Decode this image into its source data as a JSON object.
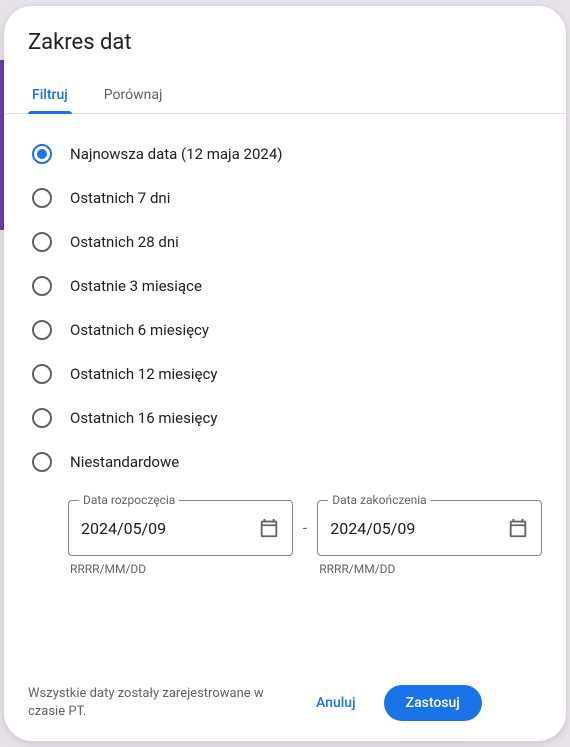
{
  "dialog": {
    "title": "Zakres dat",
    "tabs": {
      "filter": "Filtruj",
      "compare": "Porównaj"
    }
  },
  "options": [
    {
      "label": "Najnowsza data (12 maja 2024)",
      "selected": true
    },
    {
      "label": "Ostatnich 7 dni",
      "selected": false
    },
    {
      "label": "Ostatnich 28 dni",
      "selected": false
    },
    {
      "label": "Ostatnie 3 miesiące",
      "selected": false
    },
    {
      "label": "Ostatnich 6 miesięcy",
      "selected": false
    },
    {
      "label": "Ostatnich 12 miesięcy",
      "selected": false
    },
    {
      "label": "Ostatnich 16 miesięcy",
      "selected": false
    },
    {
      "label": "Niestandardowe",
      "selected": false
    }
  ],
  "dateStart": {
    "legend": "Data rozpoczęcia",
    "value": "2024/05/09",
    "hint": "RRRR/MM/DD"
  },
  "dateEnd": {
    "legend": "Data zakończenia",
    "value": "2024/05/09",
    "hint": "RRRR/MM/DD"
  },
  "separator": "-",
  "footer": {
    "note": "Wszystkie daty zostały zarejestrowane w czasie PT.",
    "cancel": "Anuluj",
    "apply": "Zastosuj"
  }
}
